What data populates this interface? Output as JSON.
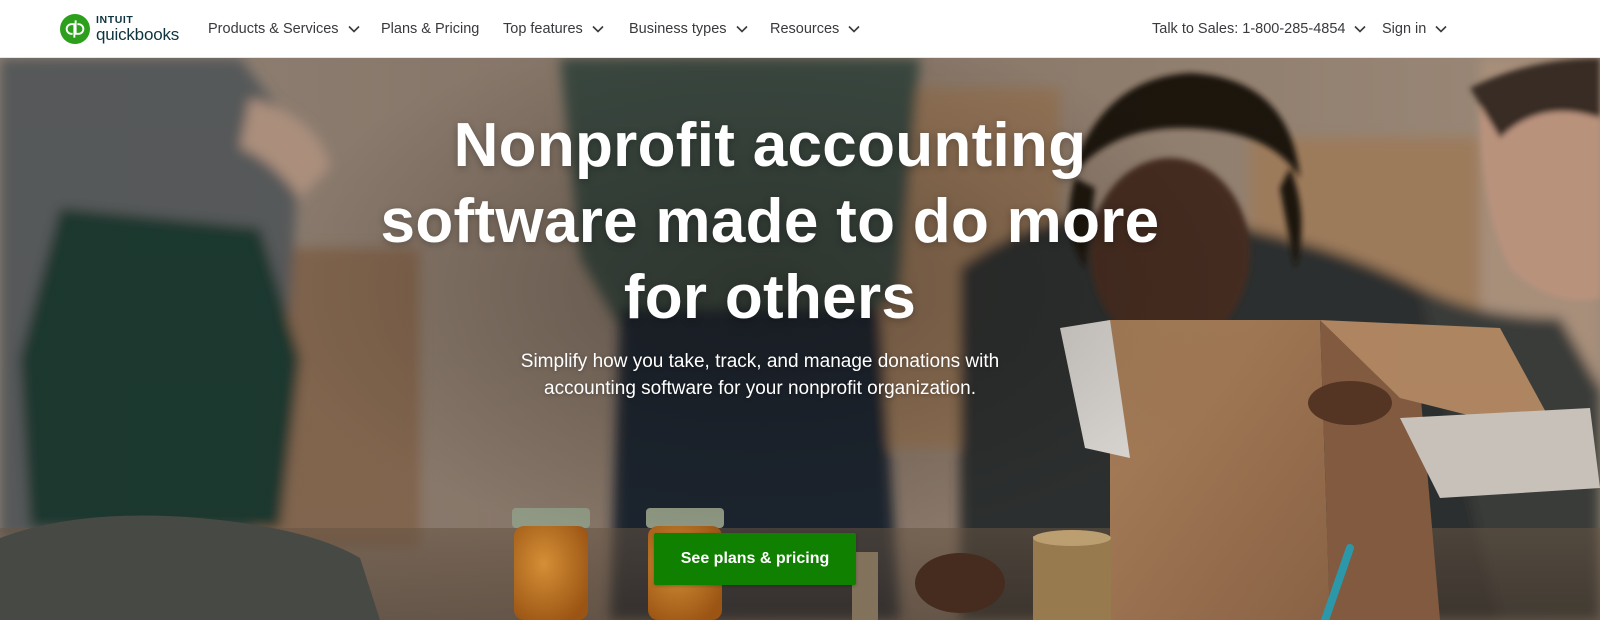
{
  "logo": {
    "intuit": "INTUIT",
    "product": "quickbooks",
    "mark": "qb"
  },
  "nav": {
    "items": [
      {
        "label": "Products & Services",
        "has_dropdown": true
      },
      {
        "label": "Plans & Pricing",
        "has_dropdown": false
      },
      {
        "label": "Top features",
        "has_dropdown": true
      },
      {
        "label": "Business types",
        "has_dropdown": true
      },
      {
        "label": "Resources",
        "has_dropdown": true
      }
    ],
    "sales": "Talk to Sales: 1-800-285-4854",
    "sign_in": "Sign in"
  },
  "hero": {
    "headline": "Nonprofit accounting software made to do more for others",
    "subhead": "Simplify how you take, track, and manage donations with accounting software for your nonprofit organization.",
    "cta": "See plans & pricing"
  },
  "colors": {
    "brand_green": "#2ca01c",
    "cta_green": "#108000",
    "nav_text": "#393a3d",
    "logo_text": "#0d333f"
  },
  "icons": {
    "dropdown": "chevron-down-icon",
    "logo": "quickbooks-logo-icon"
  }
}
